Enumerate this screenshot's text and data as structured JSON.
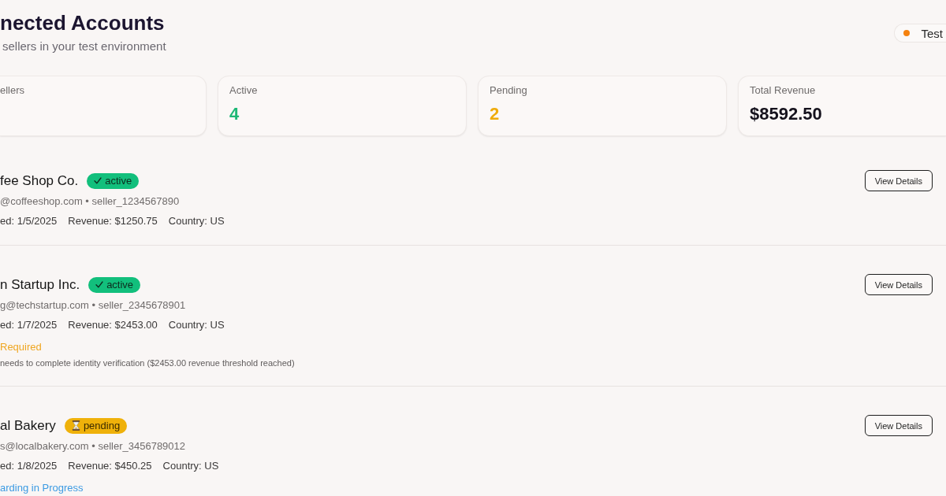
{
  "header": {
    "title": "nected Accounts",
    "subtitle": "sellers in your test environment",
    "mode_badge": {
      "label": "Test"
    }
  },
  "stats": [
    {
      "label": "ellers"
    },
    {
      "label": "Active",
      "value": "4",
      "color": "#1db876"
    },
    {
      "label": "Pending",
      "value": "2",
      "color": "#efab0c"
    },
    {
      "label": "Total Revenue",
      "value": "$8592.50",
      "color": "#15121d"
    }
  ],
  "accounts": [
    {
      "name": "fee Shop Co.",
      "status": {
        "kind": "active",
        "label": "active"
      },
      "contact": "@coffeeshop.com • seller_1234567890",
      "details": [
        "ed: 1/5/2025",
        "Revenue: $1250.75",
        "Country: US"
      ],
      "button": "View Details"
    },
    {
      "name": "n Startup Inc.",
      "status": {
        "kind": "active",
        "label": "active"
      },
      "contact": "g@techstartup.com • seller_2345678901",
      "details": [
        "ed: 1/7/2025",
        "Revenue: $2453.00",
        "Country: US"
      ],
      "notice": {
        "kind": "warning",
        "title": "Required",
        "text": "needs to complete identity verification ($2453.00 revenue threshold reached)"
      },
      "button": "View Details"
    },
    {
      "name": "al Bakery",
      "status": {
        "kind": "pending",
        "label": "pending"
      },
      "contact": "s@localbakery.com • seller_3456789012",
      "details": [
        "ed: 1/8/2025",
        "Revenue: $450.25",
        "Country: US"
      ],
      "notice": {
        "kind": "info",
        "title": "arding in Progress"
      },
      "button": "View Details"
    }
  ]
}
